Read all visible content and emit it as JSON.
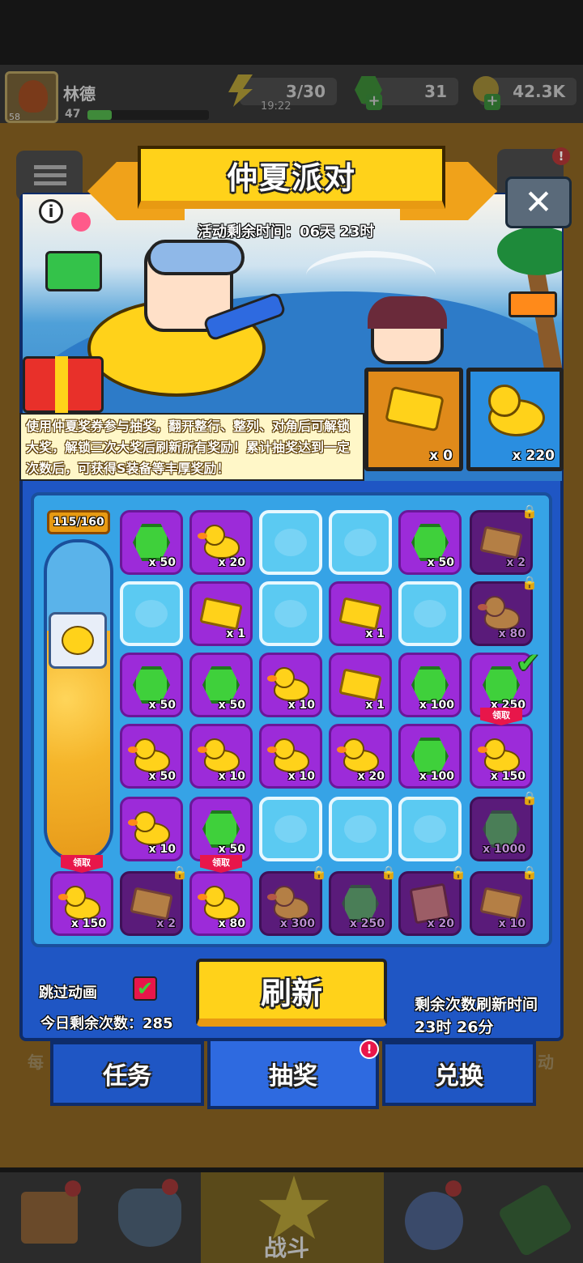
{
  "player": {
    "name": "林德",
    "level": "58",
    "xp_level": "47"
  },
  "resources": {
    "energy": "3/30",
    "energy_timer": "19:22",
    "gems": "31",
    "coins": "42.3K"
  },
  "event": {
    "title": "仲夏派对",
    "time_left": "活动剩余时间：06天 23时",
    "description": "使用仲夏奖券参与抽奖，翻开整行、整列、对角后可解锁大奖，解锁三次大奖后刷新所有奖励！累计抽奖达到一定次数后，可获得S装备等丰厚奖励！",
    "ticket_count": "x 0",
    "duck_count": "x 220"
  },
  "progress": {
    "label": "115/160",
    "fraction": 0.72
  },
  "grid": [
    [
      {
        "t": "gem",
        "q": "x 50",
        "s": "p"
      },
      {
        "t": "duck",
        "q": "x 20",
        "s": "p"
      },
      {
        "t": "",
        "q": "",
        "s": "b"
      },
      {
        "t": "",
        "q": "",
        "s": "b"
      },
      {
        "t": "gem",
        "q": "x 50",
        "s": "p"
      },
      {
        "t": "tix",
        "q": "x 2",
        "s": "d",
        "lock": true
      }
    ],
    [
      {
        "t": "",
        "q": "",
        "s": "b"
      },
      {
        "t": "tix",
        "q": "x 1",
        "s": "p"
      },
      {
        "t": "",
        "q": "",
        "s": "b"
      },
      {
        "t": "tix",
        "q": "x 1",
        "s": "p"
      },
      {
        "t": "",
        "q": "",
        "s": "b"
      },
      {
        "t": "duck",
        "q": "x 80",
        "s": "d",
        "lock": true
      }
    ],
    [
      {
        "t": "gem",
        "q": "x 50",
        "s": "p"
      },
      {
        "t": "gem",
        "q": "x 50",
        "s": "p"
      },
      {
        "t": "duck",
        "q": "x 10",
        "s": "p"
      },
      {
        "t": "tix",
        "q": "x 1",
        "s": "p"
      },
      {
        "t": "gem",
        "q": "x 100",
        "s": "p"
      },
      {
        "t": "gem",
        "q": "x 250",
        "s": "p",
        "check": true
      }
    ],
    [
      {
        "t": "duck",
        "q": "x 50",
        "s": "p"
      },
      {
        "t": "duck",
        "q": "x 10",
        "s": "p"
      },
      {
        "t": "duck",
        "q": "x 10",
        "s": "p"
      },
      {
        "t": "duck",
        "q": "x 20",
        "s": "p"
      },
      {
        "t": "gem",
        "q": "x 100",
        "s": "p"
      },
      {
        "t": "duck",
        "q": "x 150",
        "s": "p",
        "claim": true
      }
    ],
    [
      {
        "t": "duck",
        "q": "x 10",
        "s": "p"
      },
      {
        "t": "gem",
        "q": "x 50",
        "s": "p"
      },
      {
        "t": "",
        "q": "",
        "s": "b"
      },
      {
        "t": "",
        "q": "",
        "s": "b"
      },
      {
        "t": "",
        "q": "",
        "s": "b"
      },
      {
        "t": "gem",
        "q": "x 1000",
        "s": "d",
        "lock": true
      }
    ]
  ],
  "bottom_row": [
    {
      "t": "duck",
      "q": "x 150",
      "s": "p",
      "claim": true
    },
    {
      "t": "tix",
      "q": "x 2",
      "s": "d",
      "lock": true
    },
    {
      "t": "duck",
      "q": "x 80",
      "s": "p",
      "claim": true
    },
    {
      "t": "duck",
      "q": "x 300",
      "s": "d",
      "lock": true
    },
    {
      "t": "gem",
      "q": "x 250",
      "s": "d",
      "lock": true
    },
    {
      "t": "map",
      "q": "x 20",
      "s": "d",
      "lock": true
    },
    {
      "t": "tix",
      "q": "x 10",
      "s": "d",
      "lock": true
    }
  ],
  "claim_label": "领取",
  "controls": {
    "skip_label": "跳过动画",
    "skip_checked": true,
    "remaining_today": "今日剩余次数：285",
    "refresh_label": "刷新",
    "refresh_time_label": "剩余次数刷新时间",
    "refresh_time": "23时 26分"
  },
  "tabs": [
    "任务",
    "抽奖",
    "兑换"
  ],
  "side_fragments": {
    "left": "每",
    "right": "动"
  },
  "nav": {
    "battle": "战斗"
  }
}
